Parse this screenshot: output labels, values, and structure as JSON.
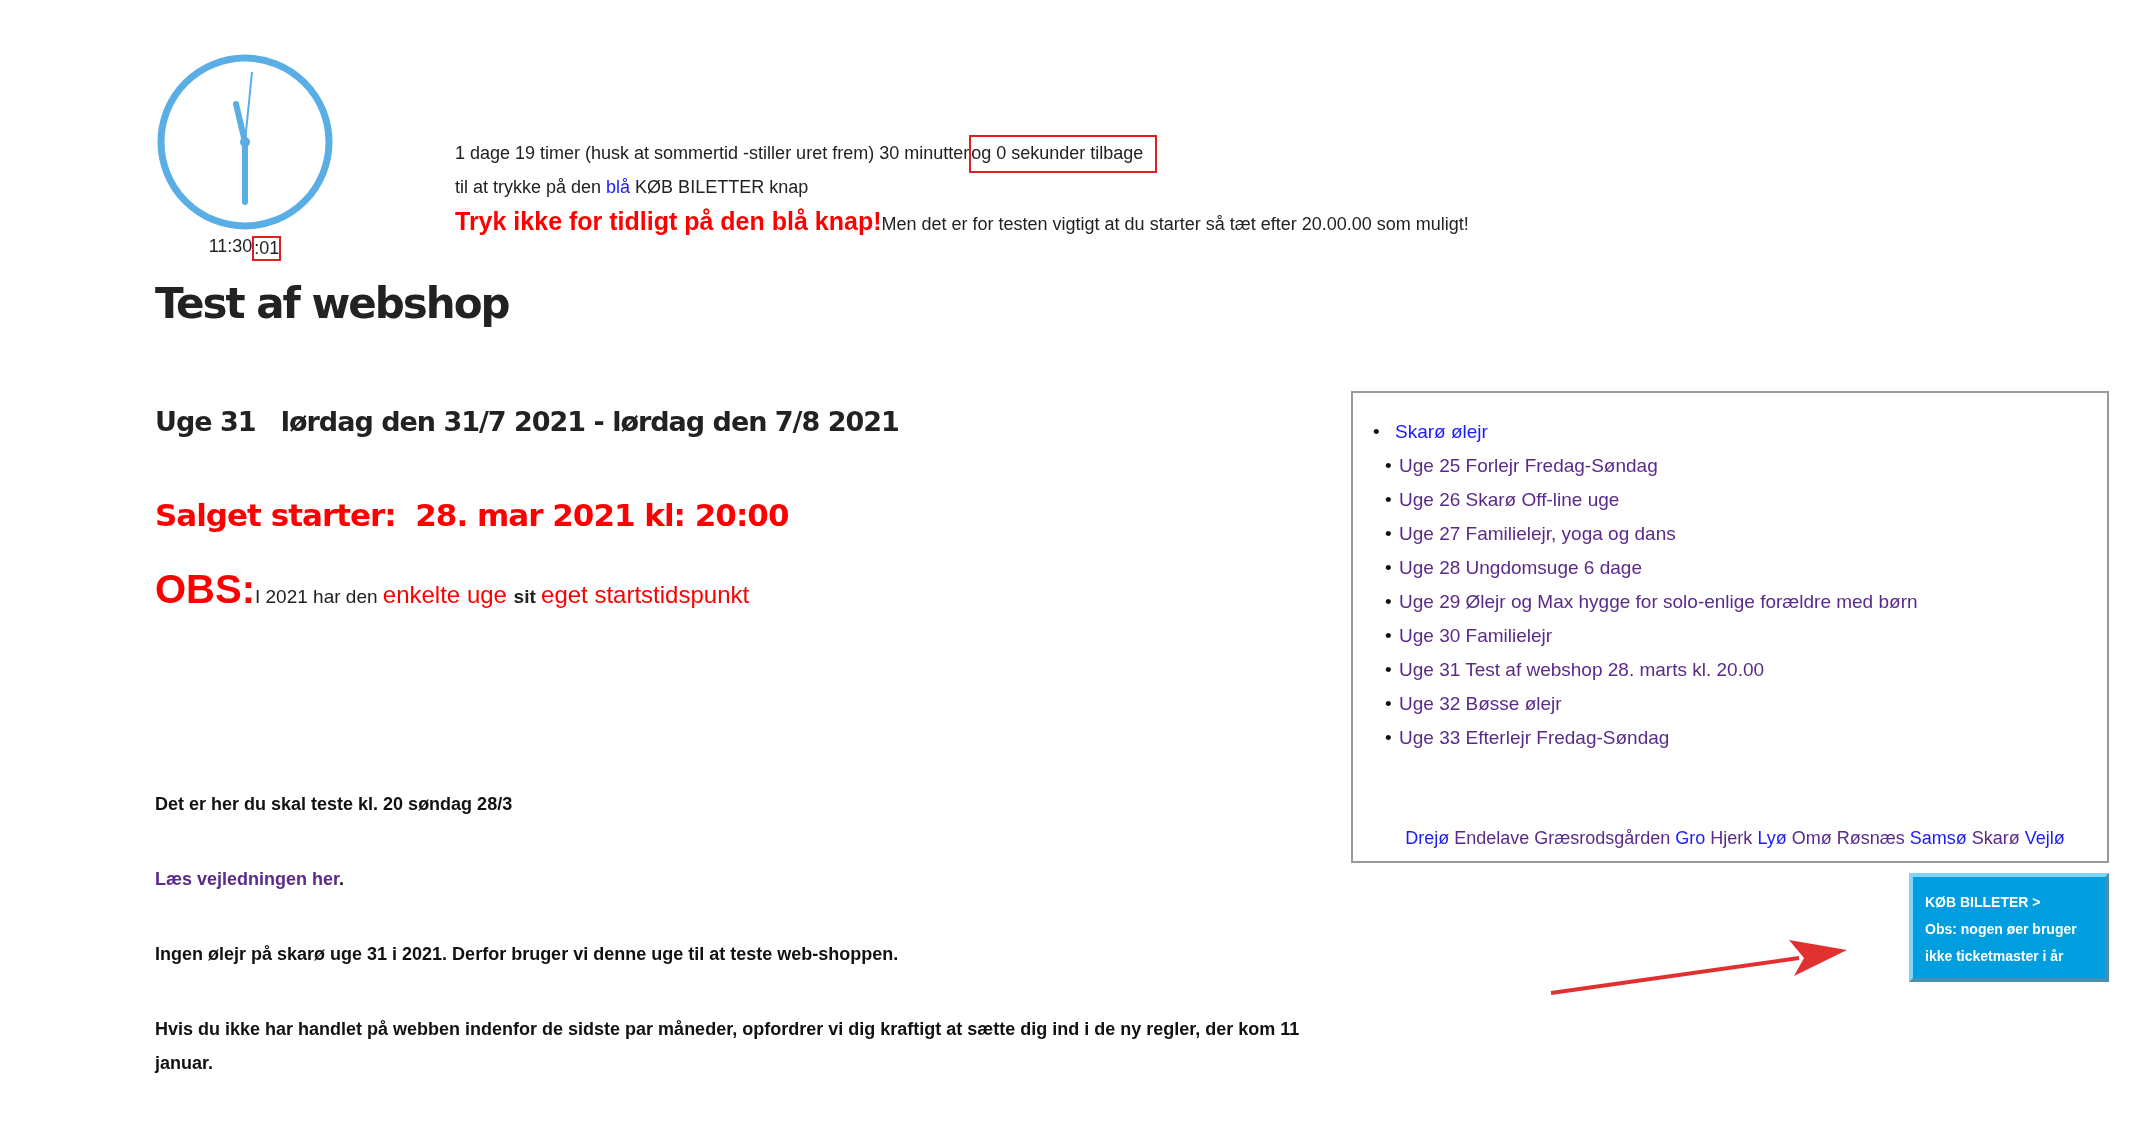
{
  "clock": {
    "time": "11:30",
    "time_highlight": ":01"
  },
  "countdown": {
    "text": "1 dage 19 timer (husk at sommertid -stiller uret frem) 30 minutter",
    "highlight": "og 0 sekunder tilbage"
  },
  "instruction": {
    "before": "til at trykke på den ",
    "link": "blå",
    "after": " KØB BILETTER knap"
  },
  "warning": {
    "emphasis": "Tryk ikke for tidligt på den blå knap!",
    "text": "Men det er for testen vigtigt at du starter så tæt efter 20.00.00 som muligt!"
  },
  "title": "Test af webshop",
  "week_heading": "Uge 31   lørdag den 31/7 2021 - lørdag den 7/8 2021",
  "sale_start": "Salget starter:  28. mar 2021 kl: 20:00",
  "obs": {
    "label": "OBS:",
    "parts": [
      {
        "kind": "plain",
        "text": "I 2021 har den "
      },
      {
        "kind": "red",
        "text": "enkelte uge "
      },
      {
        "kind": "bold",
        "text": "sit "
      },
      {
        "kind": "red",
        "text": "eget startstidspunkt"
      }
    ]
  },
  "paragraphs": [
    {
      "kind": "text",
      "text": "Det er her du skal teste kl. 20 søndag 28/3"
    },
    {
      "kind": "link",
      "text": "Læs vejledningen her",
      "suffix": "."
    },
    {
      "kind": "text",
      "text": "Ingen ølejr på skarø uge 31 i 2021. Derfor bruger vi denne uge til at teste web-shoppen."
    },
    {
      "kind": "text",
      "text": "Hvis du ikke har handlet på webben indenfor de sidste par måneder, opfordrer vi dig kraftigt at sætte dig ind i de ny regler, der kom 11 januar."
    }
  ],
  "sidebar": {
    "heading": {
      "bullet": "•",
      "text": "Skarø ølejr",
      "visited": false
    },
    "items": [
      {
        "bullet": "•",
        "text": "Uge 25 Forlejr Fredag-Søndag",
        "visited": true
      },
      {
        "bullet": "•",
        "text": "Uge 26 Skarø Off-line uge",
        "visited": true
      },
      {
        "bullet": "•",
        "text": "Uge 27 Familielejr, yoga og dans",
        "visited": true
      },
      {
        "bullet": "•",
        "text": "Uge 28 Ungdomsuge 6 dage",
        "visited": true
      },
      {
        "bullet": "•",
        "text": "Uge 29 Ølejr og Max hygge for solo-enlige forældre med børn",
        "visited": true
      },
      {
        "bullet": "•",
        "text": "Uge 30 Familielejr",
        "visited": true
      },
      {
        "bullet": "•",
        "text": "Uge 31 Test af webshop 28. marts kl. 20.00",
        "visited": true
      },
      {
        "bullet": "•",
        "text": "Uge 32 Bøsse ølejr",
        "visited": true
      },
      {
        "bullet": "•",
        "text": "Uge 33 Efterlejr Fredag-Søndag",
        "visited": true
      }
    ],
    "islands": [
      {
        "text": "Drejø",
        "visited": false
      },
      {
        "text": "Endelave",
        "visited": true
      },
      {
        "text": "Græsrodsgården",
        "visited": true
      },
      {
        "text": "Gro",
        "visited": false
      },
      {
        "text": "Hjerk",
        "visited": true
      },
      {
        "text": "Lyø",
        "visited": false
      },
      {
        "text": "Omø",
        "visited": true
      },
      {
        "text": "Røsnæs",
        "visited": true
      },
      {
        "text": "Samsø",
        "visited": false
      },
      {
        "text": "Skarø",
        "visited": true
      },
      {
        "text": "Vejlø",
        "visited": false
      }
    ]
  },
  "buy_button": {
    "lines": [
      "KØB BILLETER >",
      "Obs: nogen øer bruger",
      "ikke ticketmaster i år"
    ]
  }
}
